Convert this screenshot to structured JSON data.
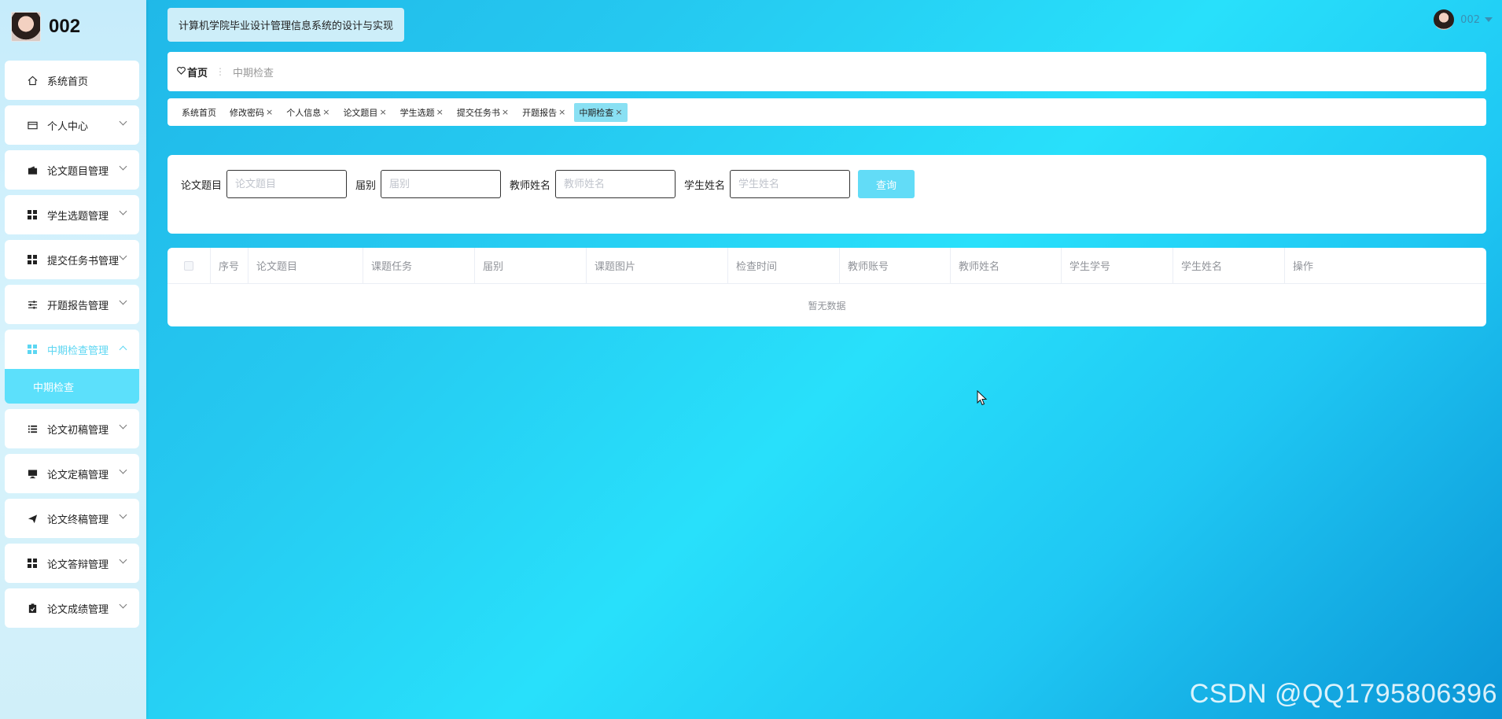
{
  "brand": {
    "name": "002"
  },
  "system_title": "计算机学院毕业设计管理信息系统的设计与实现",
  "user": {
    "name": "002"
  },
  "sidebar": {
    "items": [
      {
        "label": "系统首页",
        "icon": "home-icon"
      },
      {
        "label": "个人中心",
        "icon": "card-icon"
      },
      {
        "label": "论文题目管理",
        "icon": "wallet-icon"
      },
      {
        "label": "学生选题管理",
        "icon": "grid-icon"
      },
      {
        "label": "提交任务书管理",
        "icon": "grid-icon"
      },
      {
        "label": "开题报告管理",
        "icon": "sliders-icon"
      },
      {
        "label": "中期检查管理",
        "icon": "grid-icon"
      },
      {
        "label": "论文初稿管理",
        "icon": "list-icon"
      },
      {
        "label": "论文定稿管理",
        "icon": "monitor-icon"
      },
      {
        "label": "论文终稿管理",
        "icon": "send-icon"
      },
      {
        "label": "论文答辩管理",
        "icon": "grid-icon"
      },
      {
        "label": "论文成绩管理",
        "icon": "clipboard-icon"
      }
    ],
    "submenu": {
      "label": "中期检查"
    }
  },
  "breadcrumb": {
    "home": "首页",
    "current": "中期检查"
  },
  "tabs": [
    {
      "label": "系统首页",
      "closable": false
    },
    {
      "label": "修改密码",
      "closable": true
    },
    {
      "label": "个人信息",
      "closable": true
    },
    {
      "label": "论文题目",
      "closable": true
    },
    {
      "label": "学生选题",
      "closable": true
    },
    {
      "label": "提交任务书",
      "closable": true
    },
    {
      "label": "开题报告",
      "closable": true
    },
    {
      "label": "中期检查",
      "closable": true
    }
  ],
  "search": {
    "fields": [
      {
        "label": "论文题目",
        "placeholder": "论文题目",
        "value": ""
      },
      {
        "label": "届别",
        "placeholder": "届别",
        "value": ""
      },
      {
        "label": "教师姓名",
        "placeholder": "教师姓名",
        "value": ""
      },
      {
        "label": "学生姓名",
        "placeholder": "学生姓名",
        "value": ""
      }
    ],
    "button_label": "查询"
  },
  "table": {
    "columns": [
      "序号",
      "论文题目",
      "课题任务",
      "届别",
      "课题图片",
      "检查时间",
      "教师账号",
      "教师姓名",
      "学生学号",
      "学生姓名",
      "操作"
    ],
    "empty_text": "暂无数据"
  },
  "watermark": "CSDN @QQ1795806396",
  "colors": {
    "accent": "#5ce0fb",
    "button": "#62dcf7",
    "active_tab": "#89e0f3"
  }
}
